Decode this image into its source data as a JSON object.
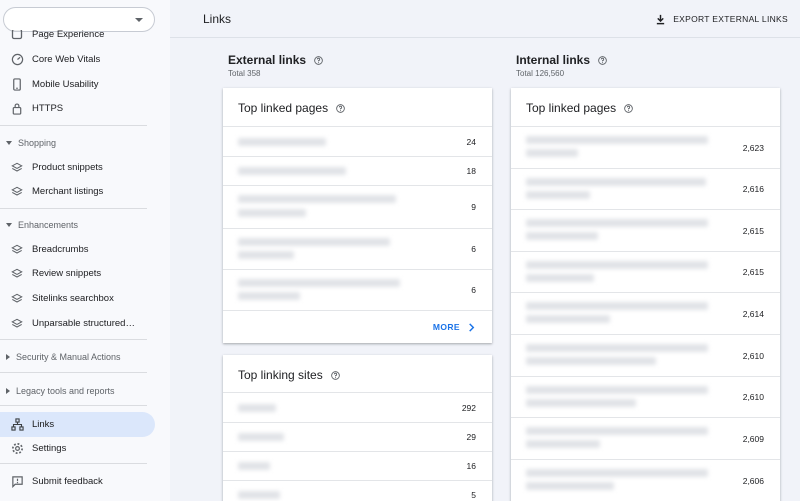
{
  "sidebar": {
    "property_selector": "",
    "items": [
      {
        "label": "Page Experience",
        "icon": "page-experience-icon"
      },
      {
        "label": "Core Web Vitals",
        "icon": "gauge-icon"
      },
      {
        "label": "Mobile Usability",
        "icon": "smartphone-icon"
      },
      {
        "label": "HTTPS",
        "icon": "lock-icon"
      },
      {
        "label": "Product snippets",
        "icon": "layers-icon"
      },
      {
        "label": "Merchant listings",
        "icon": "layers-icon"
      },
      {
        "label": "Breadcrumbs",
        "icon": "layers-icon"
      },
      {
        "label": "Review snippets",
        "icon": "layers-icon"
      },
      {
        "label": "Sitelinks searchbox",
        "icon": "layers-icon"
      },
      {
        "label": "Unparsable structured data",
        "icon": "layers-icon"
      },
      {
        "label": "Links",
        "icon": "sitemap-icon"
      },
      {
        "label": "Settings",
        "icon": "gear-icon"
      },
      {
        "label": "Submit feedback",
        "icon": "feedback-icon"
      }
    ],
    "sections": [
      "Shopping",
      "Enhancements",
      "Security & Manual Actions",
      "Legacy tools and reports"
    ]
  },
  "header": {
    "title": "Links",
    "export_label": "EXPORT EXTERNAL LINKS"
  },
  "external": {
    "title": "External links",
    "total": "Total 358",
    "top_linked_pages": {
      "title": "Top linked pages",
      "values": [
        "24",
        "18",
        "9",
        "6",
        "6"
      ],
      "more_label": "MORE"
    },
    "top_linking_sites": {
      "title": "Top linking sites",
      "values": [
        "292",
        "29",
        "16",
        "5"
      ]
    }
  },
  "internal": {
    "title": "Internal links",
    "total": "Total 126,560",
    "top_linked_pages": {
      "title": "Top linked pages",
      "values": [
        "2,623",
        "2,616",
        "2,615",
        "2,615",
        "2,614",
        "2,610",
        "2,610",
        "2,609",
        "2,606"
      ]
    }
  },
  "colors": {
    "accent": "#1a73e8",
    "active_nav": "#dbe7fb",
    "page_background": "#f1f3f9"
  }
}
